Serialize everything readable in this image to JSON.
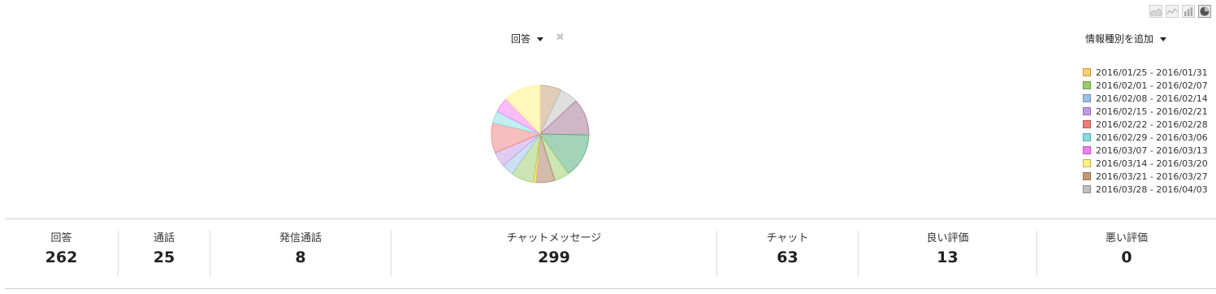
{
  "chart_types": [
    {
      "name": "area-chart-icon",
      "active": false
    },
    {
      "name": "line-chart-icon",
      "active": false
    },
    {
      "name": "bar-chart-icon",
      "active": false
    },
    {
      "name": "pie-chart-icon",
      "active": true
    }
  ],
  "metric_selector": {
    "label": "回答"
  },
  "add_info_type": {
    "label": "情報種別を追加"
  },
  "chart_data": {
    "type": "pie",
    "legend_position": "right",
    "series": [
      {
        "name": "2016/01/25 - 2016/01/31",
        "color": "#ffcc66"
      },
      {
        "name": "2016/02/01 - 2016/02/07",
        "color": "#99cc66"
      },
      {
        "name": "2016/02/08 - 2016/02/14",
        "color": "#99c2e6"
      },
      {
        "name": "2016/02/15 - 2016/02/21",
        "color": "#c299e6"
      },
      {
        "name": "2016/02/22 - 2016/02/28",
        "color": "#f27b7b"
      },
      {
        "name": "2016/02/29 - 2016/03/06",
        "color": "#80e0e0"
      },
      {
        "name": "2016/03/07 - 2016/03/13",
        "color": "#f27bf2"
      },
      {
        "name": "2016/03/14 - 2016/03/20",
        "color": "#fff07a"
      },
      {
        "name": "2016/03/21 - 2016/03/27",
        "color": "#c29a73"
      },
      {
        "name": "2016/03/28 - 2016/04/03",
        "color": "#bfbfbf"
      }
    ],
    "slices": [
      {
        "label": "回答",
        "fraction": 0.071,
        "color": "#c29a73"
      },
      {
        "label": "回答",
        "fraction": 0.06,
        "color": "#bfbfbf"
      },
      {
        "label": "回答",
        "fraction": 0.122,
        "color": "#9f6f8f"
      },
      {
        "label": "回答",
        "fraction": 0.148,
        "color": "#4aa873"
      },
      {
        "label": "回答",
        "fraction": 0.05,
        "color": "#99cc66"
      },
      {
        "label": "回答",
        "fraction": 0.063,
        "color": "#a3795e"
      },
      {
        "label": "回答",
        "fraction": 0.008,
        "color": "#ffcc33"
      },
      {
        "label": "回答",
        "fraction": 0.075,
        "color": "#99cc66"
      },
      {
        "label": "回答",
        "fraction": 0.04,
        "color": "#99c2e6"
      },
      {
        "label": "回答",
        "fraction": 0.05,
        "color": "#c299e6"
      },
      {
        "label": "回答",
        "fraction": 0.1,
        "color": "#f27b7b"
      },
      {
        "label": "回答",
        "fraction": 0.04,
        "color": "#80e0e0"
      },
      {
        "label": "回答",
        "fraction": 0.05,
        "color": "#f27bf2"
      },
      {
        "label": "回答",
        "fraction": 0.123,
        "color": "#fff07a"
      }
    ]
  },
  "stats": [
    {
      "label": "回答",
      "value": "262"
    },
    {
      "label": "通話",
      "value": "25"
    },
    {
      "label": "発信通話",
      "value": "8"
    },
    {
      "label": "チャットメッセージ",
      "value": "299"
    },
    {
      "label": "チャット",
      "value": "63"
    },
    {
      "label": "良い評価",
      "value": "13"
    },
    {
      "label": "悪い評価",
      "value": "0"
    }
  ]
}
